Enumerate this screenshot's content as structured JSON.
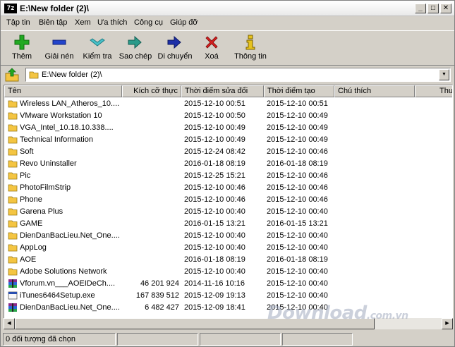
{
  "window": {
    "title": "E:\\New folder (2)\\",
    "app_icon": "7z",
    "minimize": "_",
    "maximize": "□",
    "close": "✕"
  },
  "menu": [
    "Tập tin",
    "Biên tập",
    "Xem",
    "Ưa thích",
    "Công cụ",
    "Giúp đỡ"
  ],
  "toolbar": {
    "add": "Thêm",
    "extract": "Giải nén",
    "test": "Kiểm tra",
    "copy": "Sao chép",
    "move": "Di chuyển",
    "delete": "Xoá",
    "info": "Thông tin"
  },
  "address": {
    "path": "E:\\New folder (2)\\"
  },
  "columns": {
    "name": "Tên",
    "size": "Kích cỡ thực",
    "modified": "Thời điểm sửa đổi",
    "created": "Thời điểm tạo",
    "comment": "Chú thích",
    "more": "Thu"
  },
  "rows": [
    {
      "name": "Wireless LAN_Atheros_10....",
      "size": "",
      "modified": "2015-12-10 00:51",
      "created": "2015-12-10 00:51",
      "type": "folder"
    },
    {
      "name": "VMware Workstation 10",
      "size": "",
      "modified": "2015-12-10 00:50",
      "created": "2015-12-10 00:49",
      "type": "folder"
    },
    {
      "name": "VGA_Intel_10.18.10.338....",
      "size": "",
      "modified": "2015-12-10 00:49",
      "created": "2015-12-10 00:49",
      "type": "folder"
    },
    {
      "name": "Technical Information",
      "size": "",
      "modified": "2015-12-10 00:49",
      "created": "2015-12-10 00:49",
      "type": "folder"
    },
    {
      "name": "Soft",
      "size": "",
      "modified": "2015-12-24 08:42",
      "created": "2015-12-10 00:46",
      "type": "folder"
    },
    {
      "name": "Revo Uninstaller",
      "size": "",
      "modified": "2016-01-18 08:19",
      "created": "2016-01-18 08:19",
      "type": "folder"
    },
    {
      "name": "Pic",
      "size": "",
      "modified": "2015-12-25 15:21",
      "created": "2015-12-10 00:46",
      "type": "folder"
    },
    {
      "name": "PhotoFilmStrip",
      "size": "",
      "modified": "2015-12-10 00:46",
      "created": "2015-12-10 00:46",
      "type": "folder"
    },
    {
      "name": "Phone",
      "size": "",
      "modified": "2015-12-10 00:46",
      "created": "2015-12-10 00:46",
      "type": "folder"
    },
    {
      "name": "Garena Plus",
      "size": "",
      "modified": "2015-12-10 00:40",
      "created": "2015-12-10 00:40",
      "type": "folder"
    },
    {
      "name": "GAME",
      "size": "",
      "modified": "2016-01-15 13:21",
      "created": "2016-01-15 13:21",
      "type": "folder"
    },
    {
      "name": "DienDanBacLieu.Net_One....",
      "size": "",
      "modified": "2015-12-10 00:40",
      "created": "2015-12-10 00:40",
      "type": "folder"
    },
    {
      "name": "AppLog",
      "size": "",
      "modified": "2015-12-10 00:40",
      "created": "2015-12-10 00:40",
      "type": "folder"
    },
    {
      "name": "AOE",
      "size": "",
      "modified": "2016-01-18 08:19",
      "created": "2016-01-18 08:19",
      "type": "folder"
    },
    {
      "name": "Adobe Solutions Network",
      "size": "",
      "modified": "2015-12-10 00:40",
      "created": "2015-12-10 00:40",
      "type": "folder"
    },
    {
      "name": "Vforum.vn___AOEIDeCh....",
      "size": "46 201 924",
      "modified": "2014-11-16 10:16",
      "created": "2015-12-10 00:40",
      "type": "archive"
    },
    {
      "name": "iTunes6464Setup.exe",
      "size": "167 839 512",
      "modified": "2015-12-09 19:13",
      "created": "2015-12-10 00:40",
      "type": "exe"
    },
    {
      "name": "DienDanBacLieu.Net_One....",
      "size": "6 482 427",
      "modified": "2015-12-09 18:41",
      "created": "2015-12-10 00:40",
      "type": "archive"
    }
  ],
  "status": {
    "selected": "0 đối tượng đã chọn"
  },
  "watermark": {
    "main": "Download",
    "suffix": ".com.vn"
  },
  "colors": {
    "folder": "#f4c542",
    "add": "#22a922",
    "extract": "#2244cc",
    "delete": "#d62020"
  }
}
